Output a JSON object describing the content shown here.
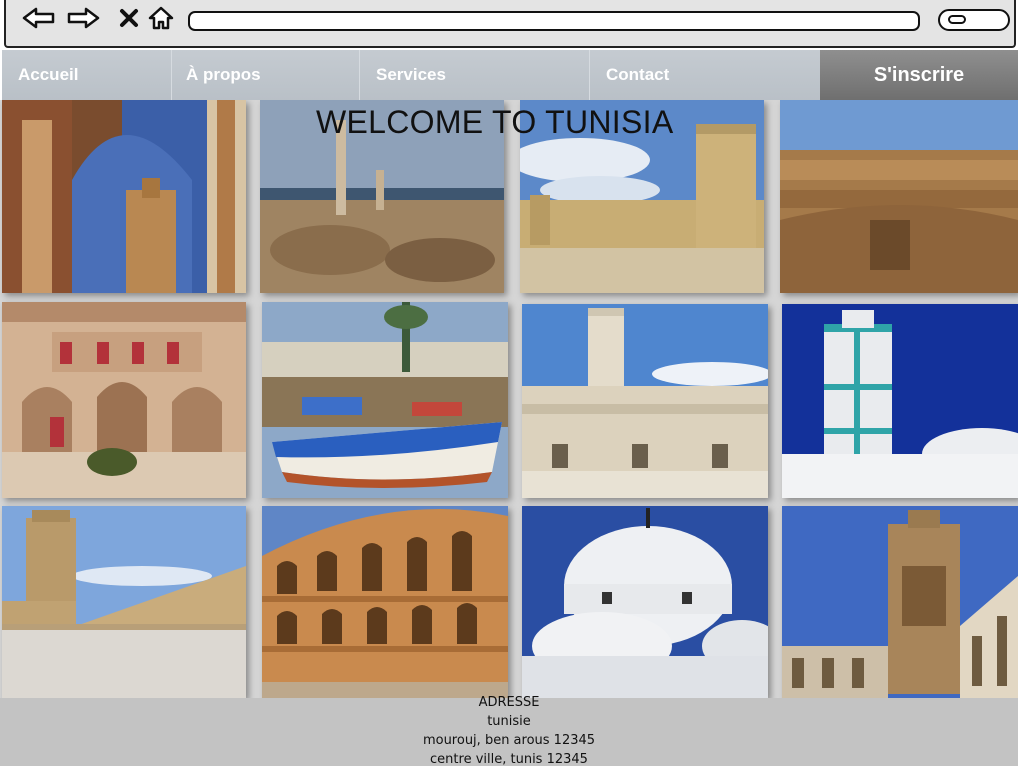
{
  "browser": {
    "icons": [
      "back-arrow-icon",
      "forward-arrow-icon",
      "close-icon",
      "home-icon",
      "search-icon"
    ]
  },
  "nav": {
    "items": [
      {
        "label": "Accueil"
      },
      {
        "label": "À propos"
      },
      {
        "label": "Services"
      },
      {
        "label": "Contact"
      }
    ],
    "cta": "S'inscrire",
    "colors": {
      "bar": "#bfc5cb",
      "cta": "#7d7d7d",
      "text": "#ffffff"
    }
  },
  "hero": {
    "title": "WELCOME TO TUNISIA"
  },
  "gallery": {
    "photos": [
      "tile-arch-minaret",
      "tile-carthage-ruins",
      "tile-ribat-tower",
      "tile-el-jem-interior",
      "tile-courtyard",
      "tile-fishing-boats",
      "tile-ribat-fortress",
      "tile-blue-minaret",
      "tile-kairouan-mosque",
      "tile-el-jem-colosseum",
      "tile-white-domes",
      "tile-zitouna-minaret"
    ]
  },
  "footer": {
    "heading": "ADRESSE",
    "lines": [
      "tunisie",
      "mourouj, ben arous 12345",
      "centre ville, tunis 12345"
    ],
    "background": "#c3c3c3"
  }
}
